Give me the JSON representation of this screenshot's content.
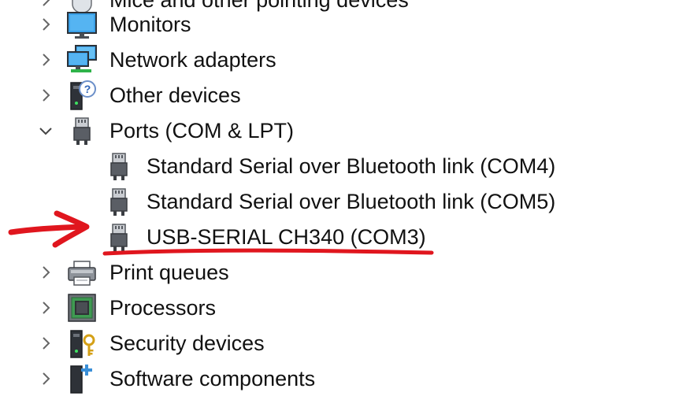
{
  "tree": {
    "items": [
      {
        "label": "Mice and other pointing devices",
        "level": 0,
        "expanded": false,
        "icon": "mouse-icon"
      },
      {
        "label": "Monitors",
        "level": 0,
        "expanded": false,
        "icon": "monitor-icon"
      },
      {
        "label": "Network adapters",
        "level": 0,
        "expanded": false,
        "icon": "network-adapter-icon"
      },
      {
        "label": "Other devices",
        "level": 0,
        "expanded": false,
        "icon": "unknown-device-icon"
      },
      {
        "label": "Ports (COM & LPT)",
        "level": 0,
        "expanded": true,
        "icon": "port-icon"
      },
      {
        "label": "Standard Serial over Bluetooth link (COM4)",
        "level": 1,
        "icon": "port-icon"
      },
      {
        "label": "Standard Serial over Bluetooth link (COM5)",
        "level": 1,
        "icon": "port-icon"
      },
      {
        "label": "USB-SERIAL CH340 (COM3)",
        "level": 1,
        "icon": "port-icon",
        "annotated": true
      },
      {
        "label": "Print queues",
        "level": 0,
        "expanded": false,
        "icon": "printer-icon"
      },
      {
        "label": "Processors",
        "level": 0,
        "expanded": false,
        "icon": "processor-icon"
      },
      {
        "label": "Security devices",
        "level": 0,
        "expanded": false,
        "icon": "security-key-icon"
      },
      {
        "label": "Software components",
        "level": 0,
        "expanded": false,
        "icon": "software-component-icon"
      }
    ]
  },
  "annotation": {
    "color": "#e0161e",
    "shapes": [
      "arrow-icon",
      "underline"
    ]
  }
}
